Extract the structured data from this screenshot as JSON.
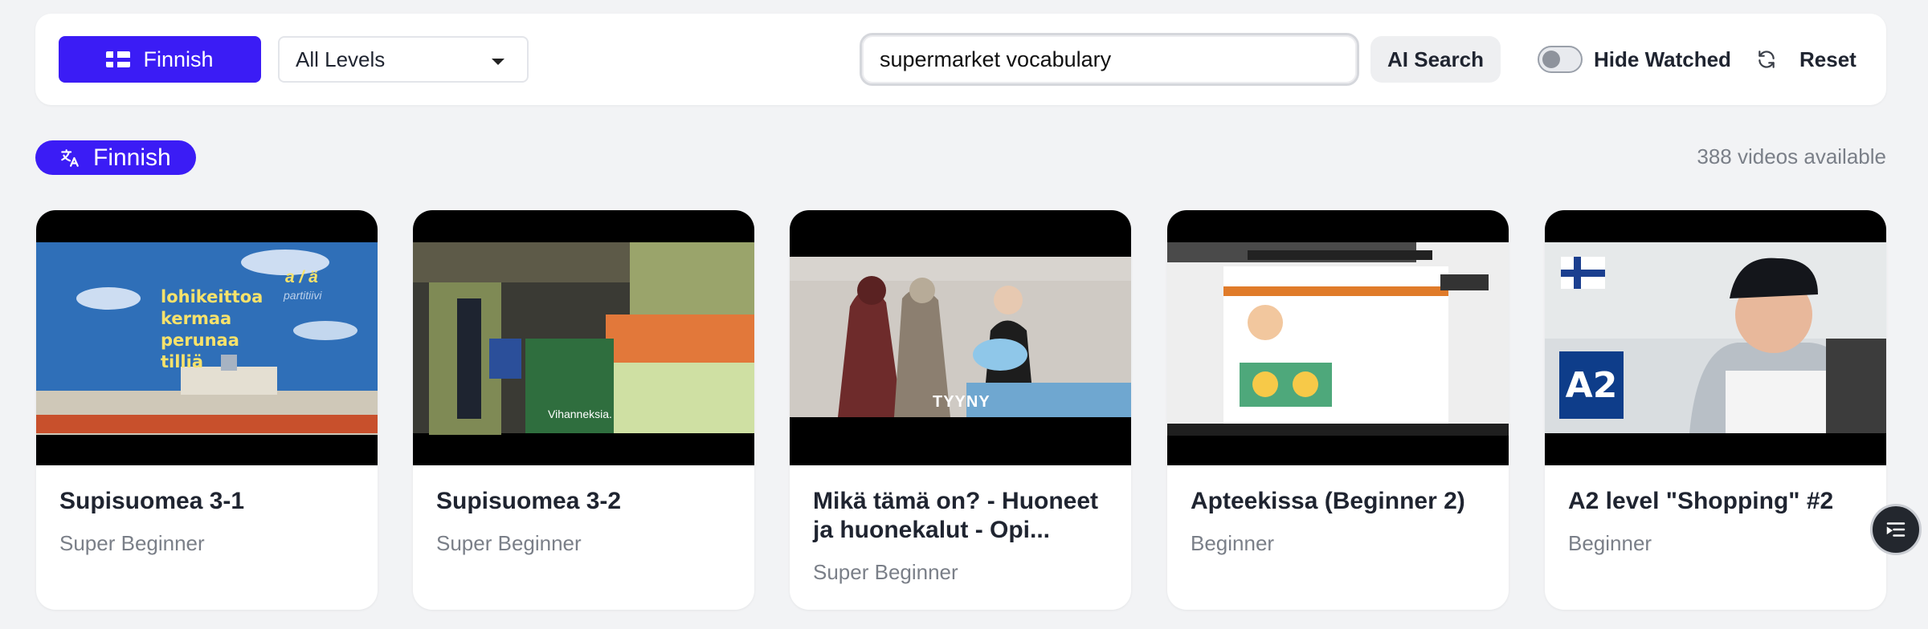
{
  "toolbar": {
    "language_button": "Finnish",
    "level_select": "All Levels",
    "search_value": "supermarket vocabulary",
    "ai_search_label": "AI Search",
    "hide_watched_label": "Hide Watched",
    "reset_label": "Reset"
  },
  "language_badge": "Finnish",
  "video_count": "388 videos available",
  "videos": [
    {
      "title": "Supisuomea 3-1",
      "level": "Super Beginner",
      "thumb_text": [
        "lohikeittoa",
        "kermaa",
        "perunaa",
        "tilliä"
      ],
      "thumb_corner": "a / ä",
      "thumb_corner_sub": "partitiivi"
    },
    {
      "title": "Supisuomea 3-2",
      "level": "Super Beginner",
      "thumb_caption": "Vihanneksia."
    },
    {
      "title": "Mikä tämä on? - Huoneet ja huonekalut - Opi...",
      "level": "Super Beginner",
      "thumb_caption": "TYYNY"
    },
    {
      "title": "Apteekissa (Beginner 2)",
      "level": "Beginner"
    },
    {
      "title": "A2 level \"Shopping\" #2",
      "level": "Beginner",
      "thumb_badge": "A2"
    }
  ],
  "colors": {
    "accent": "#3b1cf5",
    "background": "#f2f3f5"
  }
}
